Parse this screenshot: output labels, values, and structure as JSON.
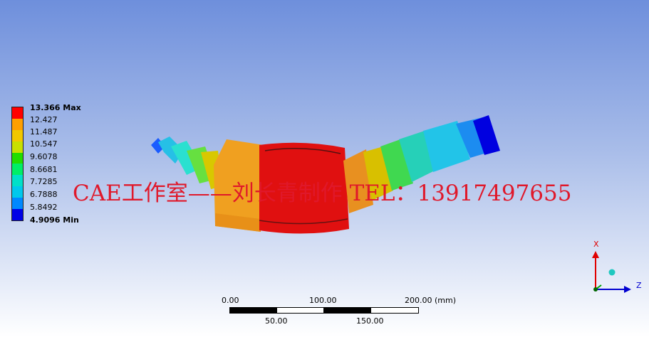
{
  "legend": {
    "max_label": "13.366 Max",
    "min_label": "4.9096 Min",
    "levels": [
      "13.366 Max",
      "12.427",
      "11.487",
      "10.547",
      "9.6078",
      "8.6681",
      "7.7285",
      "6.7888",
      "5.8492",
      "4.9096 Min"
    ],
    "colors": [
      "#ff0000",
      "#ff9f00",
      "#f2c800",
      "#c8e000",
      "#22dd00",
      "#00ee66",
      "#00e0c8",
      "#00c8ec",
      "#0088ff",
      "#0000e6"
    ]
  },
  "watermark": "CAE工作室——刘长青制作  TEL：13917497655",
  "scale_bar": {
    "top_labels": [
      "0.00",
      "100.00",
      "200.00 (mm)"
    ],
    "bottom_labels": [
      "50.00",
      "150.00"
    ]
  },
  "triad": {
    "x_label": "X",
    "z_label": "Z",
    "x_color": "#e00000",
    "z_color": "#0000d0"
  }
}
